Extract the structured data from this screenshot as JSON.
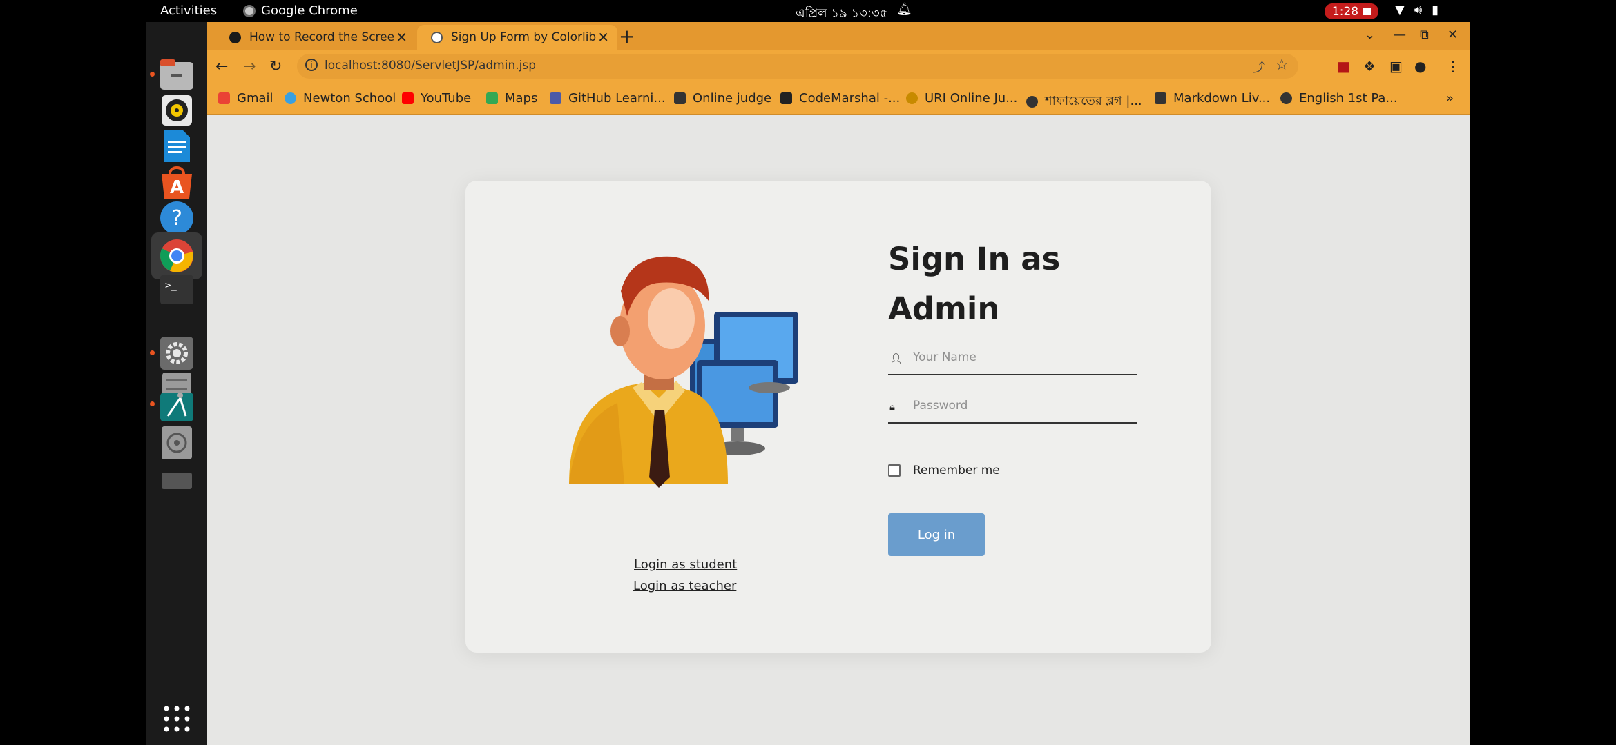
{
  "system": {
    "activities": "Activities",
    "app_name": "Google Chrome",
    "clock": "এপ্রিল ১৯  ১৩:৩৫",
    "recording_time": "1:28"
  },
  "tabs": [
    {
      "title": "How to Record the Screen",
      "active": false
    },
    {
      "title": "Sign Up Form by Colorlib",
      "active": true
    }
  ],
  "address_bar": {
    "url": "localhost:8080/ServletJSP/admin.jsp"
  },
  "bookmarks": [
    {
      "label": "Gmail",
      "color": "#ea4335"
    },
    {
      "label": "Newton School",
      "color": "#3aa0e0"
    },
    {
      "label": "YouTube",
      "color": "#ff0000"
    },
    {
      "label": "Maps",
      "color": "#34a853"
    },
    {
      "label": "GitHub Learni...",
      "color": "#4b5aa8"
    },
    {
      "label": "Online judge",
      "color": "#333333"
    },
    {
      "label": "CodeMarshal -...",
      "color": "#222222"
    },
    {
      "label": "URI Online Ju...",
      "color": "#c78a00"
    },
    {
      "label": "শাফায়েতের ব্লগ |...",
      "color": "#333333"
    },
    {
      "label": "Markdown Liv...",
      "color": "#333333"
    },
    {
      "label": "English 1st Pa...",
      "color": "#333333"
    }
  ],
  "form": {
    "title_line1": "Sign In as",
    "title_line2": "Admin",
    "name_placeholder": "Your Name",
    "password_placeholder": "Password",
    "remember_label": "Remember me",
    "login_button": "Log in",
    "student_link": "Login as student",
    "teacher_link": "Login as teacher"
  },
  "dock_icons": [
    "files-icon",
    "rhythmbox-icon",
    "writer-icon",
    "software-center-icon",
    "help-icon",
    "chrome-icon",
    "terminal-icon",
    "settings-icon",
    "archive-icon",
    "android-studio-icon",
    "disk-icon",
    "apps-grid-icon"
  ]
}
